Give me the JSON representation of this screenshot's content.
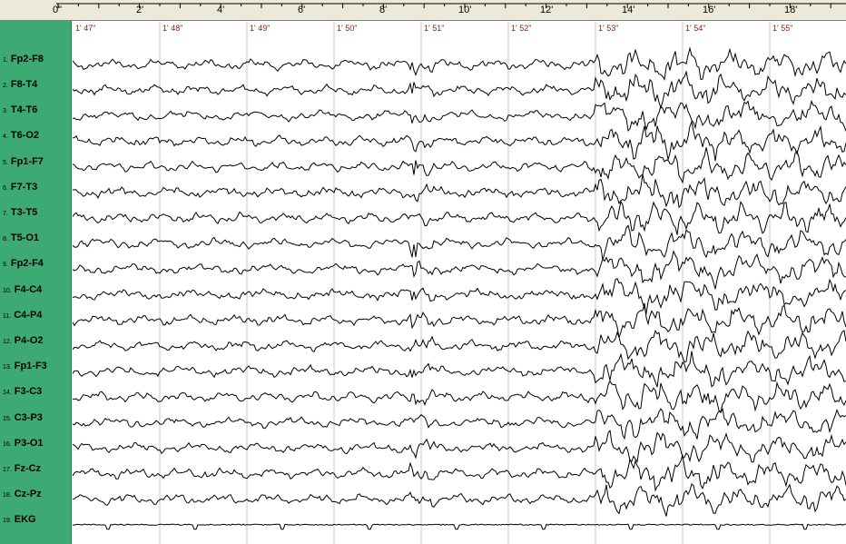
{
  "ruler": {
    "start_label": "0\"",
    "labels": [
      "2'",
      "4'",
      "6'",
      "8'",
      "10'",
      "12'",
      "14'",
      "16'",
      "18'"
    ]
  },
  "seconds": [
    "1' 47\"",
    "1' 48\"",
    "1' 49\"",
    "1' 50\"",
    "1' 51\"",
    "1' 52\"",
    "1' 53\"",
    "1' 54\"",
    "1' 55\""
  ],
  "channels": [
    {
      "num": "1.",
      "name": "Fp2-F8"
    },
    {
      "num": "2.",
      "name": "F8-T4"
    },
    {
      "num": "3.",
      "name": "T4-T6"
    },
    {
      "num": "4.",
      "name": "T6-O2"
    },
    {
      "num": "5.",
      "name": "Fp1-F7"
    },
    {
      "num": "6.",
      "name": "F7-T3"
    },
    {
      "num": "7.",
      "name": "T3-T5"
    },
    {
      "num": "8.",
      "name": "T5-O1"
    },
    {
      "num": "9.",
      "name": "Fp2-F4"
    },
    {
      "num": "10.",
      "name": "F4-C4"
    },
    {
      "num": "11.",
      "name": "C4-P4"
    },
    {
      "num": "12.",
      "name": "P4-O2"
    },
    {
      "num": "13.",
      "name": "Fp1-F3"
    },
    {
      "num": "14.",
      "name": "F3-C3"
    },
    {
      "num": "15.",
      "name": "C3-P3"
    },
    {
      "num": "16.",
      "name": "P3-O1"
    },
    {
      "num": "17.",
      "name": "Fz-Cz"
    },
    {
      "num": "18.",
      "name": "Cz-Pz"
    },
    {
      "num": "19.",
      "name": "EKG"
    }
  ],
  "colors": {
    "sidebar": "#3eaa73",
    "trace": "#000000",
    "second_label": "#8b1a1a",
    "gridline": "#c8c8c8",
    "ruler_bg": "#ece9d8"
  }
}
